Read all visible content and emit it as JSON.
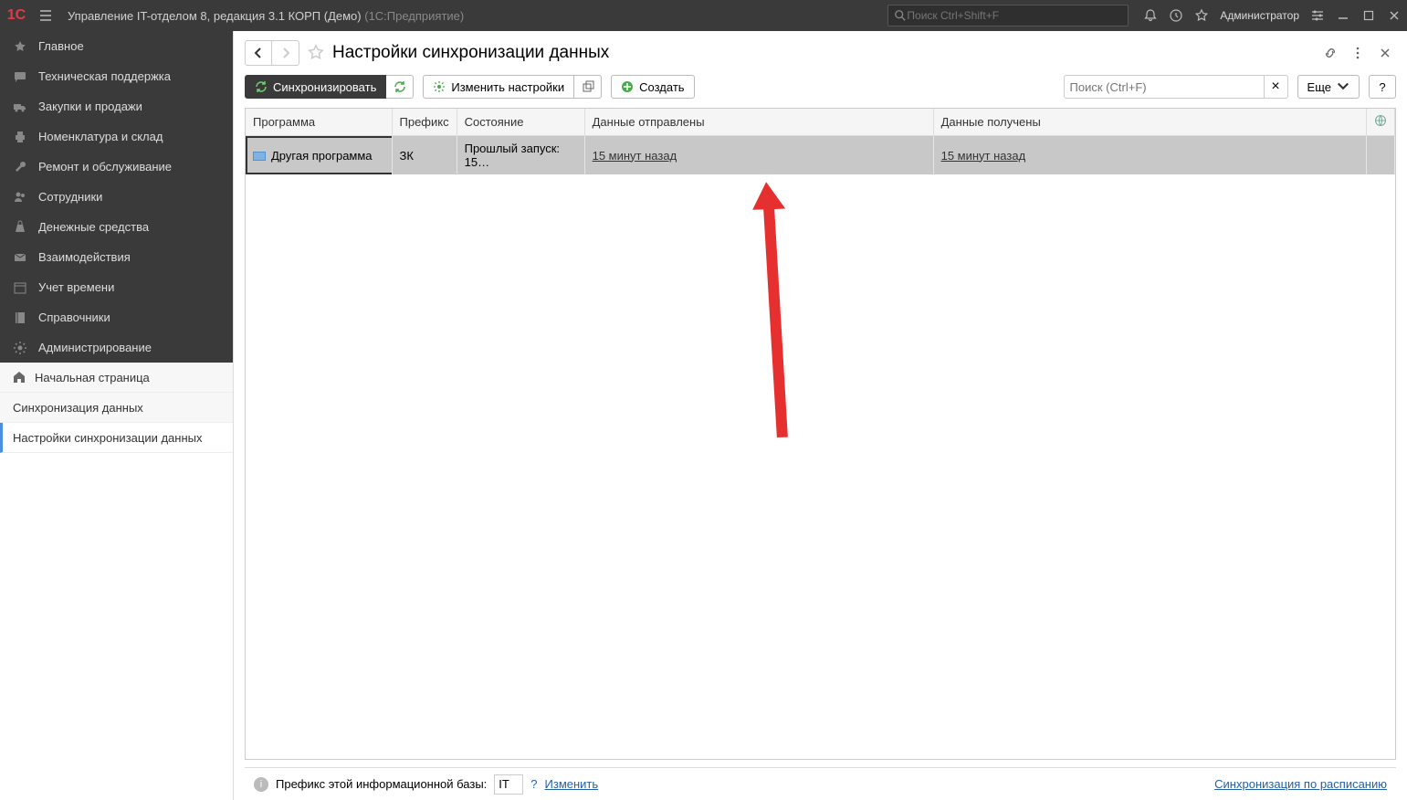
{
  "titlebar": {
    "app": "Управление IT-отделом 8, редакция 3.1 КОРП (Демо)",
    "product": "(1С:Предприятие)",
    "search_placeholder": "Поиск Ctrl+Shift+F",
    "user": "Администратор"
  },
  "sidebar": {
    "items": [
      "Главное",
      "Техническая поддержка",
      "Закупки и продажи",
      "Номенклатура и склад",
      "Ремонт и обслуживание",
      "Сотрудники",
      "Денежные средства",
      "Взаимодействия",
      "Учет времени",
      "Справочники",
      "Администрирование"
    ],
    "sub": {
      "home": "Начальная страница",
      "sync": "Синхронизация данных",
      "sync_settings": "Настройки синхронизации данных"
    }
  },
  "page": {
    "title": "Настройки синхронизации данных"
  },
  "toolbar": {
    "sync": "Синхронизировать",
    "edit": "Изменить настройки",
    "create": "Создать",
    "search_placeholder": "Поиск (Ctrl+F)",
    "more": "Еще"
  },
  "table": {
    "cols": {
      "program": "Программа",
      "prefix": "Префикс",
      "state": "Состояние",
      "sent": "Данные отправлены",
      "received": "Данные получены"
    },
    "rows": [
      {
        "program": "Другая программа",
        "prefix": "ЗК",
        "state": "Прошлый запуск: 15…",
        "sent": "15 минут назад",
        "received": "15 минут назад"
      }
    ]
  },
  "footer": {
    "prefix_label": "Префикс этой информационной базы:",
    "prefix_value": "IT",
    "change": "Изменить",
    "schedule_link": "Синхронизация по расписанию"
  }
}
